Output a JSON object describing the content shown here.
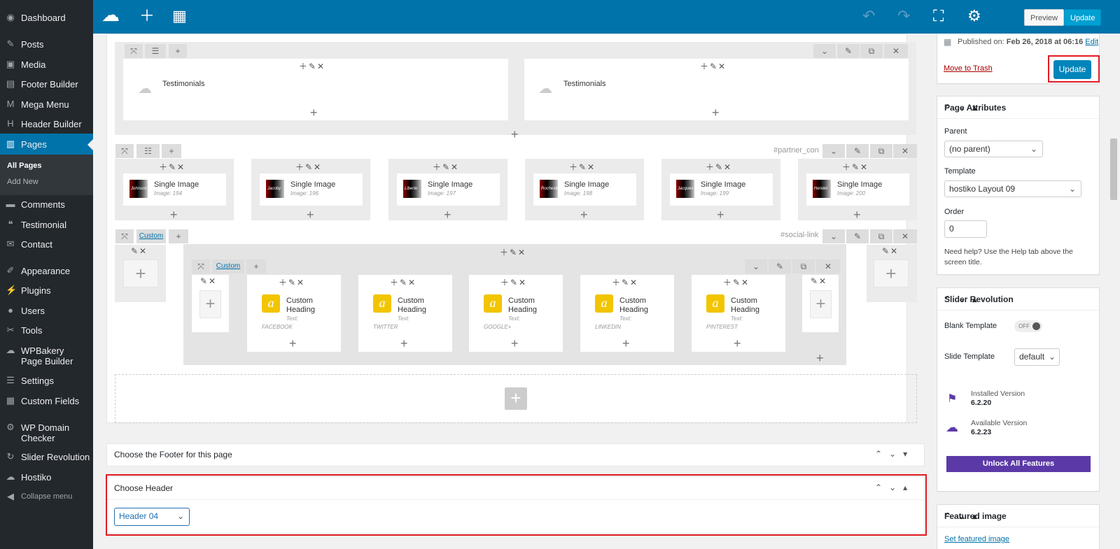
{
  "sidebar": {
    "items": [
      {
        "label": "Dashboard",
        "icon": "dashboard-icon",
        "glyph": "◉"
      },
      {
        "label": "Posts",
        "icon": "pushpin-icon",
        "glyph": "✎"
      },
      {
        "label": "Media",
        "icon": "media-icon",
        "glyph": "▣"
      },
      {
        "label": "Footer Builder",
        "icon": "footer-builder-icon",
        "glyph": "▤"
      },
      {
        "label": "Mega Menu",
        "icon": "mega-menu-icon",
        "glyph": "M"
      },
      {
        "label": "Header Builder",
        "icon": "header-builder-icon",
        "glyph": "H"
      },
      {
        "label": "Pages",
        "icon": "pages-icon",
        "glyph": "▥"
      },
      {
        "label": "Comments",
        "icon": "comments-icon",
        "glyph": "▬"
      },
      {
        "label": "Testimonial",
        "icon": "quote-icon",
        "glyph": "❝"
      },
      {
        "label": "Contact",
        "icon": "mail-icon",
        "glyph": "✉"
      },
      {
        "label": "Appearance",
        "icon": "brush-icon",
        "glyph": "✐"
      },
      {
        "label": "Plugins",
        "icon": "plugin-icon",
        "glyph": "⚡"
      },
      {
        "label": "Users",
        "icon": "user-icon",
        "glyph": "●"
      },
      {
        "label": "Tools",
        "icon": "wrench-icon",
        "glyph": "✂"
      },
      {
        "label": "WPBakery Page Builder",
        "icon": "cloud-icon",
        "glyph": "☁"
      },
      {
        "label": "Settings",
        "icon": "settings-icon",
        "glyph": "☰"
      },
      {
        "label": "Custom Fields",
        "icon": "fields-icon",
        "glyph": "▦"
      },
      {
        "label": "WP Domain Checker",
        "icon": "gear-icon",
        "glyph": "⚙"
      },
      {
        "label": "Slider Revolution",
        "icon": "refresh-icon",
        "glyph": "↻"
      },
      {
        "label": "Hostiko",
        "icon": "cloud-icon",
        "glyph": "☁"
      },
      {
        "label": "Collapse menu",
        "icon": "collapse-icon",
        "glyph": "◀"
      }
    ],
    "submenu": [
      "All Pages",
      "Add New"
    ]
  },
  "toolbar": {
    "preview": "Preview",
    "update": "Update"
  },
  "builder": {
    "testimonials": [
      "Testimonials",
      "Testimonials"
    ],
    "partner_id": "#partner_con",
    "images": [
      {
        "title": "Single Image",
        "sub": "Image: 194",
        "logo": "Johnson"
      },
      {
        "title": "Single Image",
        "sub": "Image: 196",
        "logo": "Jacoby"
      },
      {
        "title": "Single Image",
        "sub": "Image: 197",
        "logo": "Liberte"
      },
      {
        "title": "Single Image",
        "sub": "Image: 198",
        "logo": "Rochester"
      },
      {
        "title": "Single Image",
        "sub": "Image: 199",
        "logo": "Jacques"
      },
      {
        "title": "Single Image",
        "sub": "Image: 200",
        "logo": "Hendel"
      }
    ],
    "custom_label": "Custom",
    "social_id": "#social-link",
    "headings": [
      {
        "title": "Custom Heading",
        "text_label": "Text:",
        "text": "FACEBOOK"
      },
      {
        "title": "Custom Heading",
        "text_label": "Text:",
        "text": "TWITTER"
      },
      {
        "title": "Custom Heading",
        "text_label": "Text:",
        "text": "GOOGLE+"
      },
      {
        "title": "Custom Heading",
        "text_label": "Text:",
        "text": "LINKEDIN"
      },
      {
        "title": "Custom Heading",
        "text_label": "Text:",
        "text": "PINTEREST"
      }
    ]
  },
  "footer_box": {
    "title": "Choose the Footer for this page"
  },
  "header_box": {
    "title": "Choose Header",
    "selected": "Header 04"
  },
  "publish": {
    "published_label": "Published on:",
    "published_date": "Feb 26, 2018 at 06:16",
    "edit": "Edit",
    "trash": "Move to Trash",
    "update": "Update"
  },
  "page_attributes": {
    "title": "Page Attributes",
    "parent_label": "Parent",
    "parent_value": "(no parent)",
    "template_label": "Template",
    "template_value": "hostiko Layout 09",
    "order_label": "Order",
    "order_value": "0",
    "help": "Need help? Use the Help tab above the screen title."
  },
  "slider_revolution": {
    "title": "Slider Revolution",
    "blank_label": "Blank Template",
    "blank_toggle": "OFF",
    "slide_label": "Slide Template",
    "slide_value": "default",
    "installed_label": "Installed Version",
    "installed_value": "6.2.20",
    "available_label": "Available Version",
    "available_value": "6.2.23",
    "unlock": "Unlock All Features"
  },
  "featured": {
    "title": "Featured image",
    "link": "Set featured image"
  },
  "colors": {
    "accent": "#0073aa",
    "sidebar": "#23282d",
    "highlight": "#e31b23",
    "purple": "#5b3aa7"
  }
}
